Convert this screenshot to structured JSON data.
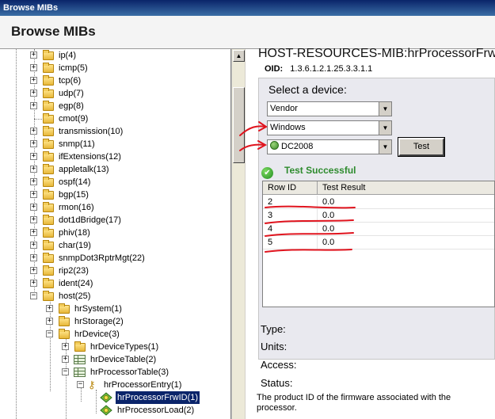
{
  "window": {
    "title": "Browse MIBs"
  },
  "header": {
    "title": "Browse MIBs"
  },
  "tree": {
    "items": [
      {
        "label": "ip(4)"
      },
      {
        "label": "icmp(5)"
      },
      {
        "label": "tcp(6)"
      },
      {
        "label": "udp(7)"
      },
      {
        "label": "egp(8)"
      },
      {
        "label": "cmot(9)"
      },
      {
        "label": "transmission(10)"
      },
      {
        "label": "snmp(11)"
      },
      {
        "label": "ifExtensions(12)"
      },
      {
        "label": "appletalk(13)"
      },
      {
        "label": "ospf(14)"
      },
      {
        "label": "bgp(15)"
      },
      {
        "label": "rmon(16)"
      },
      {
        "label": "dot1dBridge(17)"
      },
      {
        "label": "phiv(18)"
      },
      {
        "label": "char(19)"
      },
      {
        "label": "snmpDot3RptrMgt(22)"
      },
      {
        "label": "rip2(23)"
      },
      {
        "label": "ident(24)"
      },
      {
        "label": "host(25)"
      },
      {
        "label": "hrSystem(1)"
      },
      {
        "label": "hrStorage(2)"
      },
      {
        "label": "hrDevice(3)"
      },
      {
        "label": "hrDeviceTypes(1)"
      },
      {
        "label": "hrDeviceTable(2)"
      },
      {
        "label": "hrProcessorTable(3)"
      },
      {
        "label": "hrProcessorEntry(1)"
      },
      {
        "label": "hrProcessorFrwID(1)"
      },
      {
        "label": "hrProcessorLoad(2)"
      }
    ]
  },
  "details": {
    "mib_title": "HOST-RESOURCES-MIB:hrProcessorFrwI",
    "oid_label": "OID:",
    "oid_value": "1.3.6.1.2.1.25.3.3.1.1",
    "select_label": "Select a device:",
    "combos": [
      {
        "value": "Vendor"
      },
      {
        "value": "Windows"
      },
      {
        "value": "DC2008"
      }
    ],
    "test_button": "Test",
    "status": "Test Successful",
    "grid": {
      "headers": [
        "Row ID",
        "Test Result"
      ],
      "rows": [
        {
          "id": "2",
          "result": "0.0"
        },
        {
          "id": "3",
          "result": "0.0"
        },
        {
          "id": "4",
          "result": "0.0"
        },
        {
          "id": "5",
          "result": "0.0"
        }
      ]
    },
    "properties": {
      "type_label": "Type:",
      "units_label": "Units:",
      "access_label": "Access:",
      "status_label": "Status:"
    },
    "description": "The product ID of the firmware associated with the processor."
  }
}
